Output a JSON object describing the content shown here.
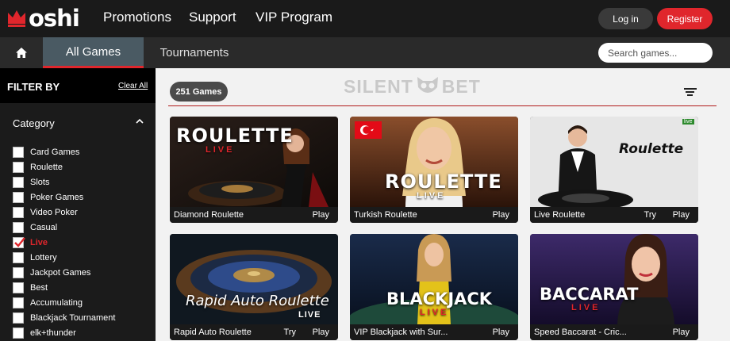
{
  "brand": {
    "name": "oshi",
    "accent": "#e0262c"
  },
  "nav": {
    "links": [
      "Promotions",
      "Support",
      "VIP Program"
    ],
    "login_label": "Log in",
    "register_label": "Register"
  },
  "tabs": {
    "all_games": "All Games",
    "tournaments": "Tournaments"
  },
  "search": {
    "placeholder": "Search games..."
  },
  "sidebar": {
    "filter_title": "FILTER BY",
    "clear_label": "Clear All",
    "category_title": "Category",
    "categories": [
      {
        "label": "Card Games",
        "checked": false
      },
      {
        "label": "Roulette",
        "checked": false
      },
      {
        "label": "Slots",
        "checked": false
      },
      {
        "label": "Poker Games",
        "checked": false
      },
      {
        "label": "Video Poker",
        "checked": false
      },
      {
        "label": "Casual",
        "checked": false
      },
      {
        "label": "Live",
        "checked": true
      },
      {
        "label": "Lottery",
        "checked": false
      },
      {
        "label": "Jackpot Games",
        "checked": false
      },
      {
        "label": "Best",
        "checked": false
      },
      {
        "label": "Accumulating",
        "checked": false
      },
      {
        "label": "Blackjack Tournament",
        "checked": false
      },
      {
        "label": "elk+thunder",
        "checked": false
      }
    ]
  },
  "main": {
    "count_label": "251 Games",
    "watermark": {
      "left": "SILENT",
      "right": "BET"
    },
    "games": [
      {
        "name": "Diamond Roulette",
        "play": "Play",
        "art_title": "ROULETTE",
        "art_sub": "LIVE"
      },
      {
        "name": "Turkish Roulette",
        "play": "Play",
        "art_title": "ROULETTE",
        "art_sub": "LIVE"
      },
      {
        "name": "Live Roulette",
        "try": "Try",
        "play": "Play",
        "art_title": "Roulette",
        "art_badge": "live"
      },
      {
        "name": "Rapid Auto Roulette",
        "try": "Try",
        "play": "Play",
        "art_title": "Rapid Auto Roulette",
        "art_sub": "LIVE"
      },
      {
        "name": "VIP Blackjack with Sur...",
        "play": "Play",
        "art_title": "BLACKJACK",
        "art_sub": "LIVE"
      },
      {
        "name": "Speed Baccarat - Cric...",
        "play": "Play",
        "art_title": "BACCARAT",
        "art_sub": "LIVE"
      }
    ]
  }
}
